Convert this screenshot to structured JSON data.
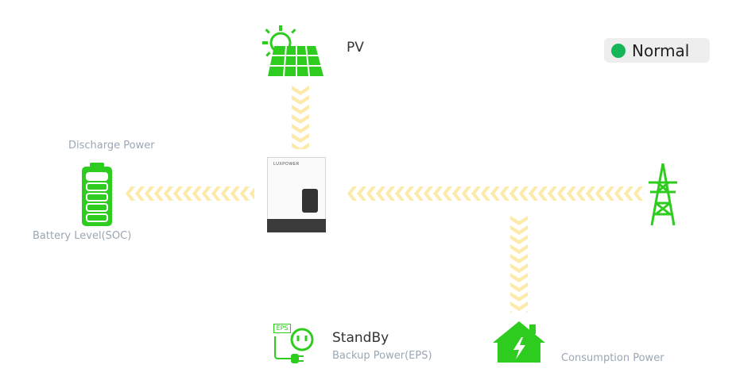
{
  "status": {
    "label": "Normal",
    "color": "#15b657"
  },
  "pv": {
    "label": "PV",
    "icon": "solar-panel-icon"
  },
  "battery": {
    "discharge_label": "Discharge Power",
    "soc_label": "Battery Level(SOC)",
    "icon": "battery-icon"
  },
  "inverter": {
    "brand": "LUXPOWER",
    "icon": "inverter-icon"
  },
  "grid": {
    "icon": "power-tower-icon"
  },
  "eps": {
    "state": "StandBy",
    "label": "Backup Power(EPS)",
    "icon_text": "EPS",
    "icon": "eps-plug-icon"
  },
  "consumption": {
    "label": "Consumption Power",
    "icon": "house-lightning-icon"
  },
  "colors": {
    "accent_green": "#2ecc1f",
    "flow_yellow": "#fde9a8"
  }
}
